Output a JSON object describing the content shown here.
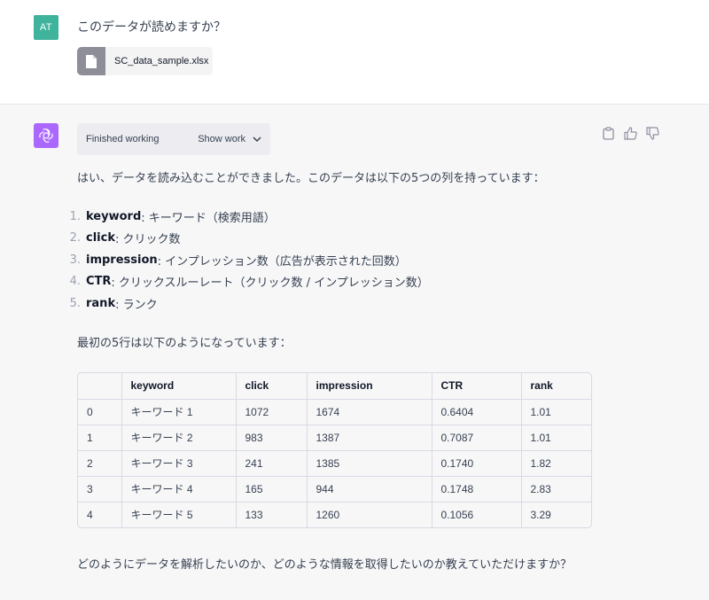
{
  "user": {
    "avatar_initials": "AT",
    "avatar_color": "#3fb39b",
    "message": "このデータが読めますか？",
    "file": {
      "name": "SC_data_sample.xlsx",
      "icon": "document-icon"
    }
  },
  "assistant": {
    "avatar_color": "#ab68ff",
    "status": "Finished working",
    "show_work_label": "Show work",
    "actions": [
      "clipboard-icon",
      "thumbs-up-icon",
      "thumbs-down-icon"
    ],
    "intro": "はい、データを読み込むことができました。このデータは以下の5つの列を持っています：",
    "columns": [
      {
        "num": "1.",
        "name": "keyword",
        "desc": ": キーワード（検索用語）"
      },
      {
        "num": "2.",
        "name": "click",
        "desc": ": クリック数"
      },
      {
        "num": "3.",
        "name": "impression",
        "desc": ": インプレッション数（広告が表示された回数）"
      },
      {
        "num": "4.",
        "name": "CTR",
        "desc": ": クリックスルーレート（クリック数 / インプレッション数）"
      },
      {
        "num": "5.",
        "name": "rank",
        "desc": ": ランク"
      }
    ],
    "table_intro": "最初の5行は以下のようになっています：",
    "table": {
      "headers": [
        "",
        "keyword",
        "click",
        "impression",
        "CTR",
        "rank"
      ],
      "rows": [
        [
          "0",
          "キーワード 1",
          "1072",
          "1674",
          "0.6404",
          "1.01"
        ],
        [
          "1",
          "キーワード 2",
          "983",
          "1387",
          "0.7087",
          "1.01"
        ],
        [
          "2",
          "キーワード 3",
          "241",
          "1385",
          "0.1740",
          "1.82"
        ],
        [
          "3",
          "キーワード 4",
          "165",
          "944",
          "0.1748",
          "2.83"
        ],
        [
          "4",
          "キーワード 5",
          "133",
          "1260",
          "0.1056",
          "3.29"
        ]
      ]
    },
    "closing": "どのようにデータを解析したいのか、どのような情報を取得したいのか教えていただけますか？"
  }
}
